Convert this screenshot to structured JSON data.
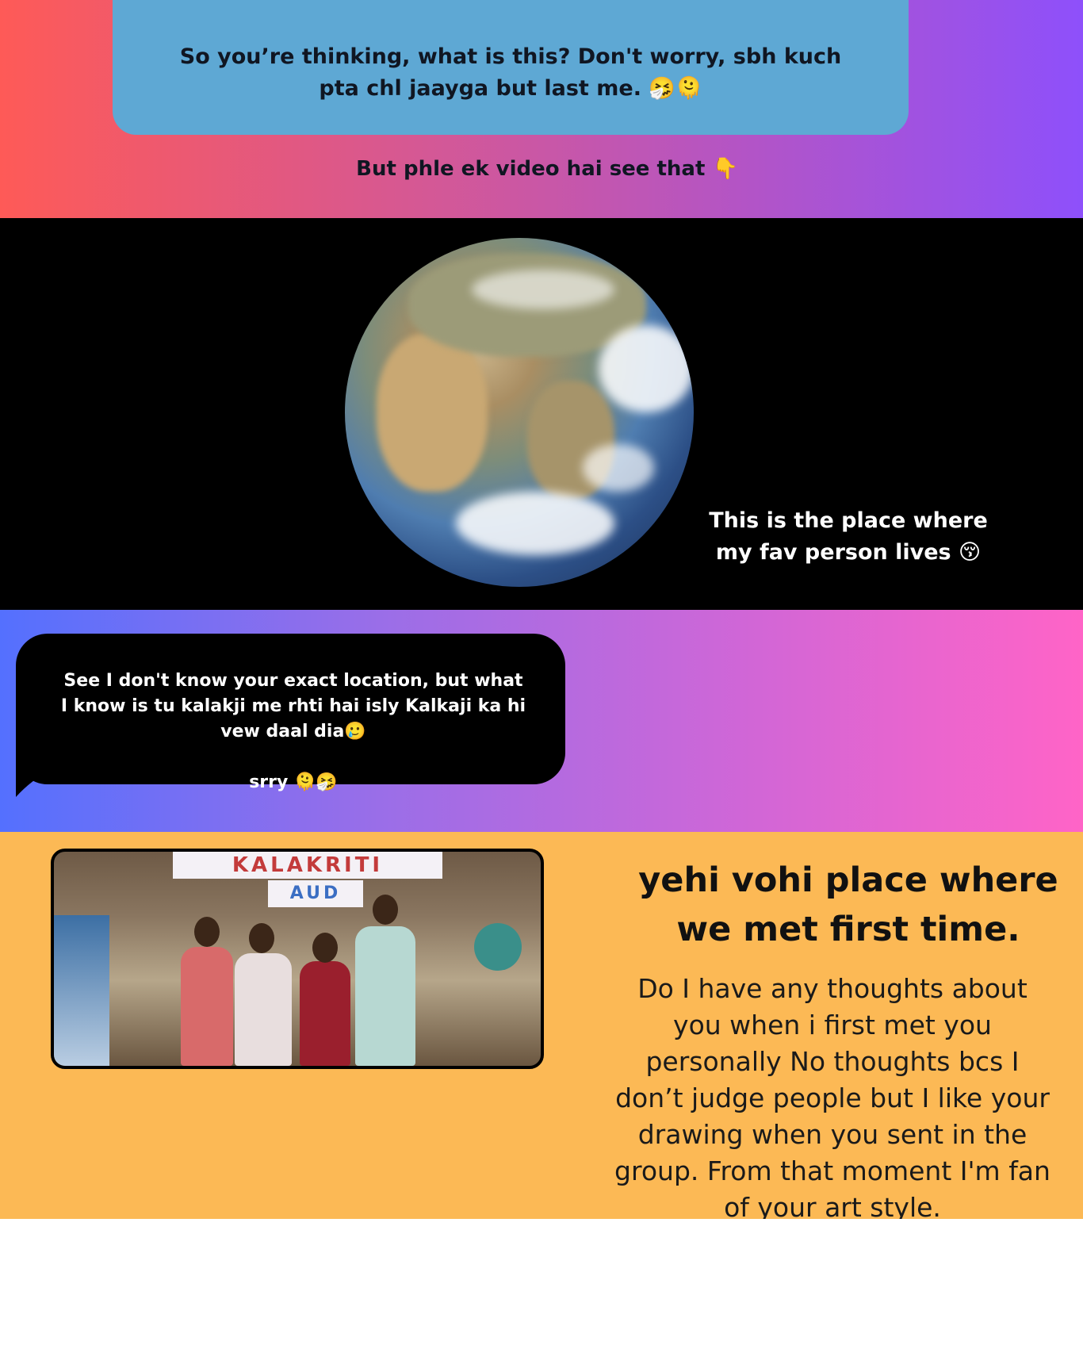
{
  "section_intro": {
    "bubble_text": "So you’re thinking, what is this? Don't worry, sbh kuch pta chl jaayga but last me. 🤧🫠",
    "subtext": "But phle ek video hai see that 👇"
  },
  "section_globe": {
    "caption": "This is the place where my fav person lives 😚"
  },
  "section_location": {
    "bubble_text": "See I don't know your exact location, but what I know is tu kalakji me rhti hai isly Kalkaji ka hi vew daal dia🥲\n\nsrry 🫠🤧"
  },
  "section_meet": {
    "photo_banner": "KALAKRITI",
    "photo_banner_sub": "AUD",
    "heading": "yehi vohi place where we met first time.",
    "body": "Do I have any thoughts about you when i first met you personally No thoughts bcs I don’t judge people but I like your drawing when you sent in the group. From that moment I'm fan of your art style."
  }
}
